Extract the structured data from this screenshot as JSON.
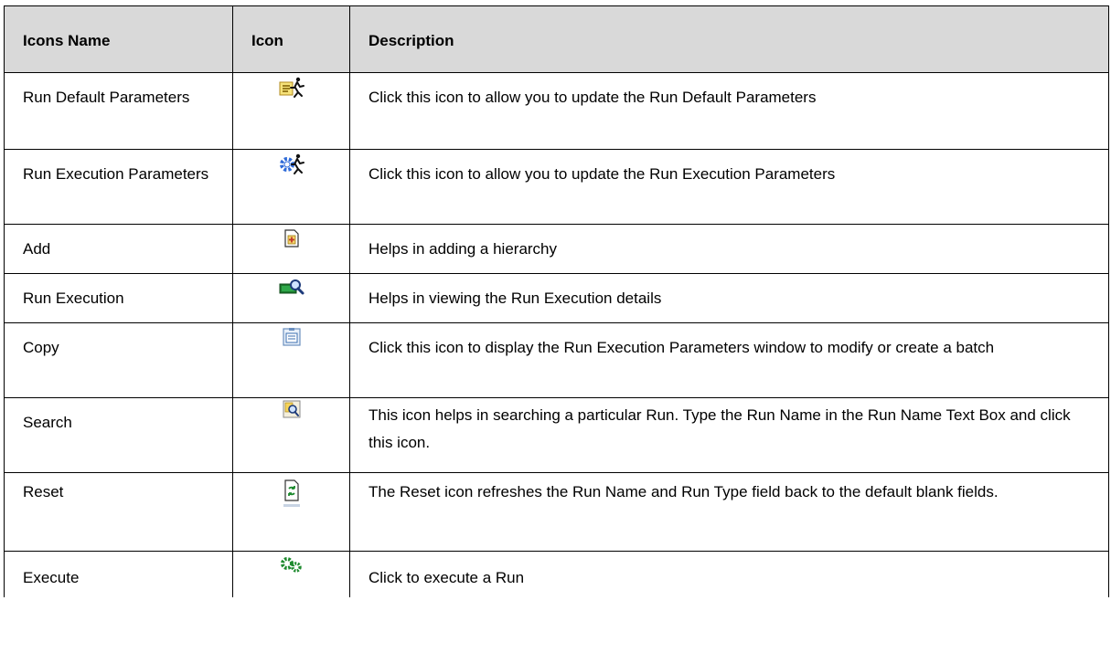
{
  "table": {
    "headers": [
      "Icons Name",
      "Icon",
      "Description"
    ],
    "rows": [
      {
        "name": "Run Default Parameters",
        "icon": "run-default-parameters-icon",
        "description": "Click this icon to allow you to update the Run Default Parameters"
      },
      {
        "name": "Run Execution Parameters",
        "icon": "run-execution-parameters-icon",
        "description": "Click this icon to allow you to update the Run Execution Parameters"
      },
      {
        "name": "Add",
        "icon": "add-icon",
        "description": "Helps in adding a hierarchy"
      },
      {
        "name": "Run Execution",
        "icon": "run-execution-icon",
        "description": "Helps in viewing the Run Execution details"
      },
      {
        "name": "Copy",
        "icon": "copy-icon",
        "description": "Click this icon to display the Run Execution Parameters window to modify or create a batch"
      },
      {
        "name": "Search",
        "icon": "search-icon",
        "description": "This icon helps in searching a particular Run. Type the Run Name in the Run Name Text Box and click this icon."
      },
      {
        "name": "Reset",
        "icon": "reset-icon",
        "description": "The Reset icon refreshes the Run Name and Run Type field back to the default blank fields."
      },
      {
        "name": "Execute",
        "icon": "execute-icon",
        "description": "Click to execute a Run"
      }
    ]
  }
}
